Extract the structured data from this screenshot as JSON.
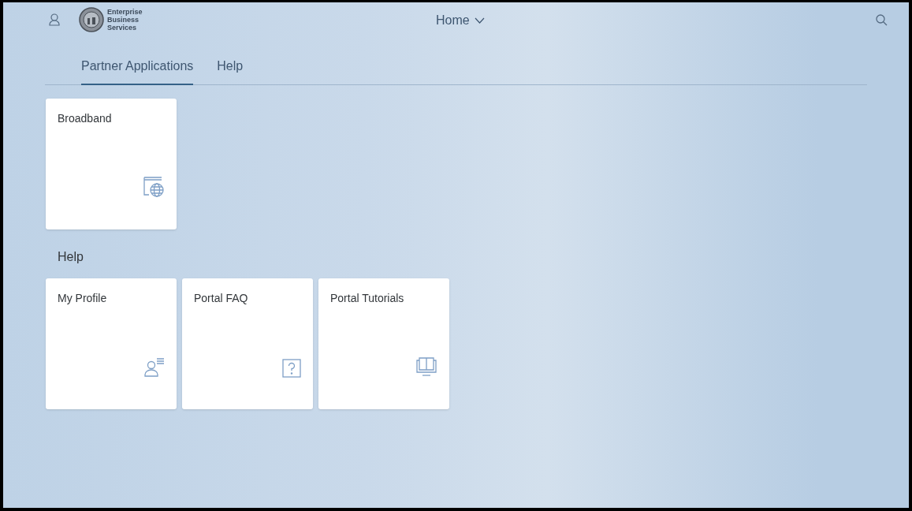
{
  "header": {
    "logo_text": "Enterprise Business Services",
    "title": "Home"
  },
  "tabs": [
    {
      "label": "Partner Applications",
      "selected": true
    },
    {
      "label": "Help",
      "selected": false
    }
  ],
  "groups": [
    {
      "tiles": [
        {
          "title": "Broadband",
          "kind": "web"
        }
      ]
    },
    {
      "title": "Help",
      "tiles": [
        {
          "title": "My Profile",
          "kind": "profile"
        },
        {
          "title": "Portal FAQ",
          "kind": "question"
        },
        {
          "title": "Portal Tutorials",
          "kind": "tutorial"
        }
      ]
    }
  ]
}
